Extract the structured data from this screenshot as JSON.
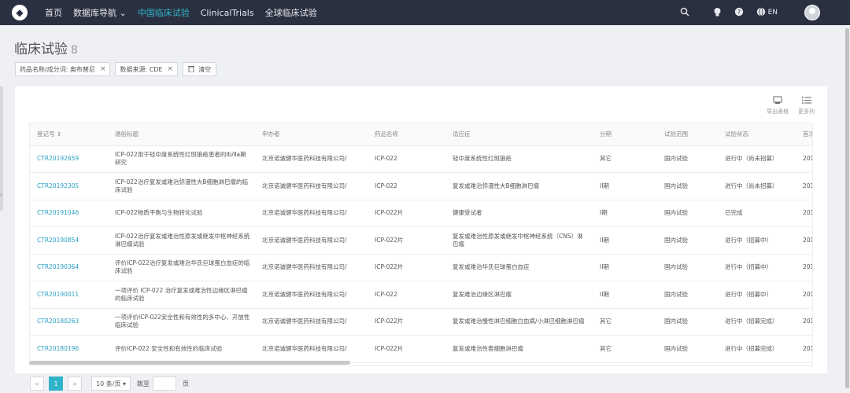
{
  "nav": {
    "items": [
      {
        "label": "首页",
        "active": false
      },
      {
        "label": "数据库导航 ⌄",
        "active": false
      },
      {
        "label": "中国临床试验",
        "active": true
      },
      {
        "label": "ClinicalTrials",
        "active": false
      },
      {
        "label": "全球临床试验",
        "active": false
      }
    ],
    "lang": "EN",
    "icons": [
      "search-icon",
      "bulb-icon",
      "help-icon",
      "globe-icon",
      "user-avatar"
    ]
  },
  "page": {
    "title": "临床试验",
    "count": "8"
  },
  "filters": [
    {
      "label": "药品名称/成分词: 奥布替尼"
    },
    {
      "label": "数据来源: CDE"
    }
  ],
  "clear_label": "清空",
  "tools": {
    "export_label": "导出表格",
    "more_label": "更多列"
  },
  "table": {
    "headers": [
      "登记号 ⇕",
      "通俗标题",
      "申办者",
      "药品名称",
      "适应症",
      "分期",
      "试验范围",
      "试验状态",
      "首次"
    ],
    "rows": [
      [
        "CTR20192659",
        "ICP-022用于轻中度系统性红斑狼疮患者的Ib/Ⅱa期研究",
        "北京诺诚健华医药科技有限公司/",
        "ICP-022",
        "轻中度系统性红斑狼疮",
        "其它",
        "国内试验",
        "进行中（尚未招募）",
        "201"
      ],
      [
        "CTR20192305",
        "ICP-022治疗复发或难治弥漫性大B细胞淋巴瘤的临床试验",
        "北京诺诚健华医药科技有限公司/",
        "ICP-022",
        "复发或难治弥漫性大B细胞淋巴瘤",
        "II期",
        "国内试验",
        "进行中（尚未招募）",
        "201"
      ],
      [
        "CTR20191046",
        "ICP-022物质平衡与生物转化试验",
        "北京诺诚健华医药科技有限公司/",
        "ICP-022片",
        "健康受试者",
        "I期",
        "国内试验",
        "已完成",
        "201"
      ],
      [
        "CTR20190854",
        "ICP-022治疗复发或难治性原发或继发中枢神经系统淋巴瘤试验",
        "北京诺诚健华医药科技有限公司/",
        "ICP-022片",
        "复发或难治性原发或继发中枢神经系统（CNS）淋巴瘤",
        "II期",
        "国内试验",
        "进行中（招募中）",
        "201"
      ],
      [
        "CTR20190364",
        "评价ICP-022治疗复发或难治华氏巨球蛋白血症的临床试验",
        "北京诺诚健华医药科技有限公司/",
        "ICP-022片",
        "复发或难治华氏巨球蛋白血症",
        "II期",
        "国内试验",
        "进行中（招募中）",
        "201"
      ],
      [
        "CTR20190011",
        "一项评价 ICP-022 治疗复发或难治性边缘区淋巴瘤的临床试验",
        "北京诺诚健华医药科技有限公司/",
        "ICP-022",
        "复发难治边缘区淋巴瘤",
        "II期",
        "国内试验",
        "进行中（招募中）",
        "201"
      ],
      [
        "CTR20180263",
        "一项评价ICP-022安全性和有效性的多中心、开放性临床试验",
        "北京诺诚健华医药科技有限公司/",
        "ICP-022片",
        "复发或难治慢性淋巴细胞白血病/小淋巴细胞淋巴瘤",
        "其它",
        "国内试验",
        "进行中（招募完成）",
        "201"
      ],
      [
        "CTR20180196",
        "评价ICP-022 安全性和有效性的临床试验",
        "北京诺诚健华医药科技有限公司/",
        "ICP-022片",
        "复发或难治性套细胞淋巴瘤",
        "其它",
        "国内试验",
        "进行中（招募完成）",
        "201"
      ]
    ]
  },
  "pagination": {
    "prev": "<",
    "current": "1",
    "next": ">",
    "page_size": "10 条/页 ▾",
    "goto_label": "跳至",
    "page_label": "页"
  },
  "colors": {
    "topbar": "#2b3040",
    "accent": "#2fb3c9",
    "link": "#2a9fc4"
  }
}
